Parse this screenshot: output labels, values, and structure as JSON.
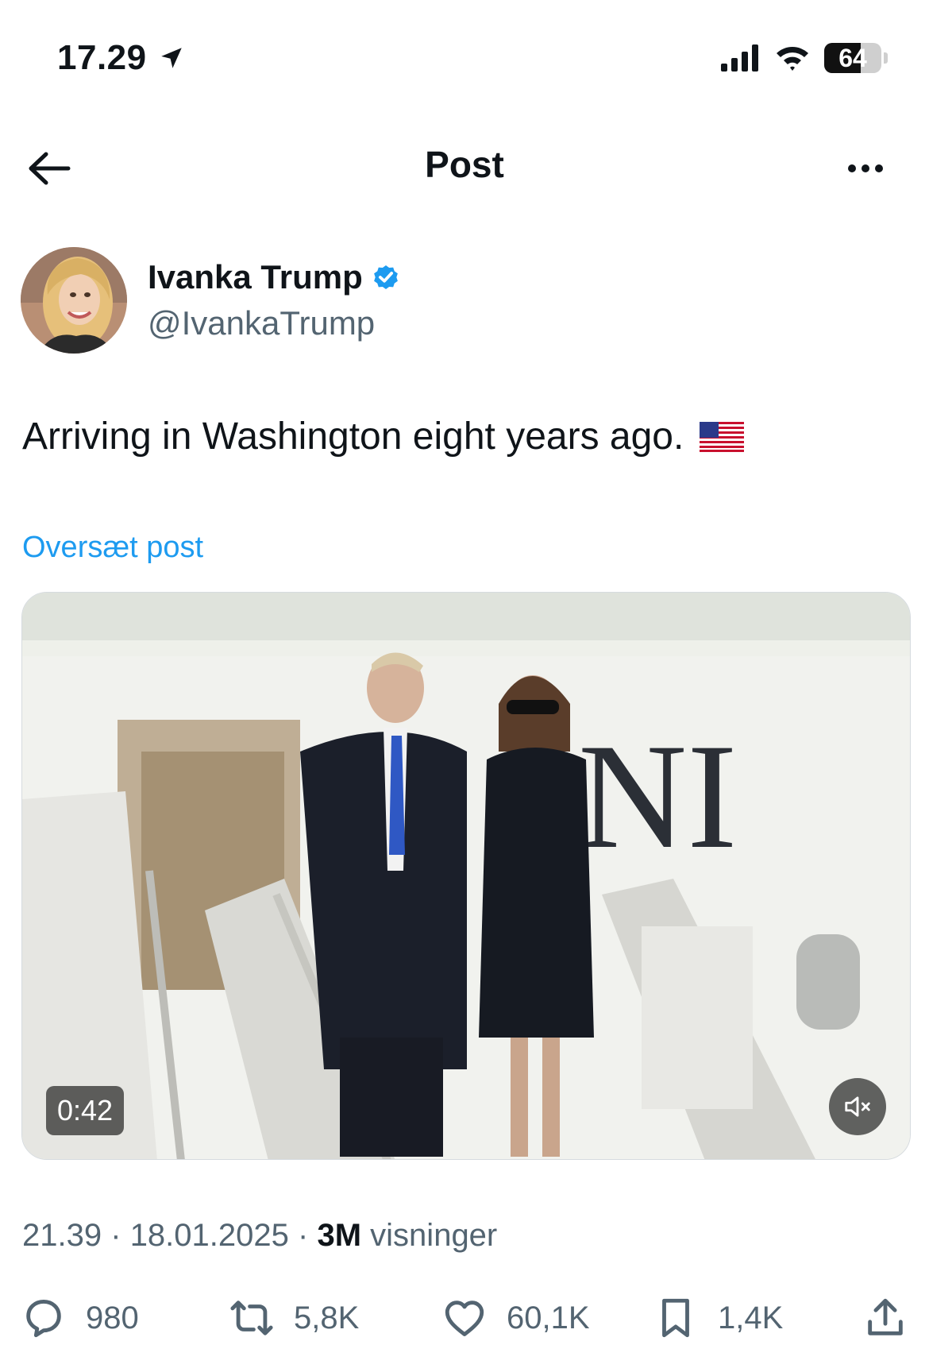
{
  "status_bar": {
    "time": "17.29",
    "battery": "64",
    "battery_level": 0.64
  },
  "nav": {
    "title": "Post"
  },
  "author": {
    "name": "Ivanka Trump",
    "handle": "@IvankaTrump",
    "verified": true
  },
  "post": {
    "text": "Arriving in Washington eight years ago.",
    "emoji": "flag-us",
    "translate_label": "Oversæt post"
  },
  "media": {
    "type": "video",
    "duration": "0:42",
    "muted": true
  },
  "meta": {
    "time": "21.39",
    "separator": "·",
    "date": "18.01.2025",
    "views_count": "3M",
    "views_label": "visninger"
  },
  "actions": {
    "replies": "980",
    "reposts": "5,8K",
    "likes": "60,1K",
    "bookmarks": "1,4K"
  },
  "colors": {
    "accent": "#1d9bf0",
    "secondary_text": "#536471",
    "primary_text": "#0f1419"
  }
}
